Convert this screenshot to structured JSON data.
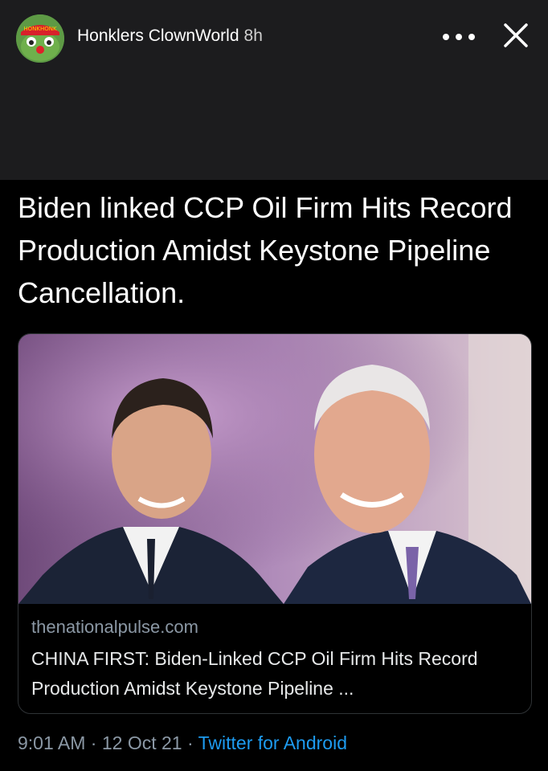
{
  "story": {
    "author_name": "Honklers ClownWorld",
    "time_ago": "8h",
    "avatar_label": "HONKHONK"
  },
  "tweet": {
    "text": "Biden linked CCP Oil Firm Hits Record Production Amidst Keystone Pipeline Cancellation.",
    "timestamp": "9:01 AM",
    "date": "12 Oct 21",
    "separator": "·",
    "source": "Twitter for Android"
  },
  "card": {
    "domain": "thenationalpulse.com",
    "title": "CHINA FIRST: Biden-Linked CCP Oil Firm Hits Record Production Amidst Keystone Pipeline ..."
  },
  "colors": {
    "header_bg": "#1c1c1e",
    "muted": "#8b98a5",
    "link": "#1d9bf0"
  }
}
